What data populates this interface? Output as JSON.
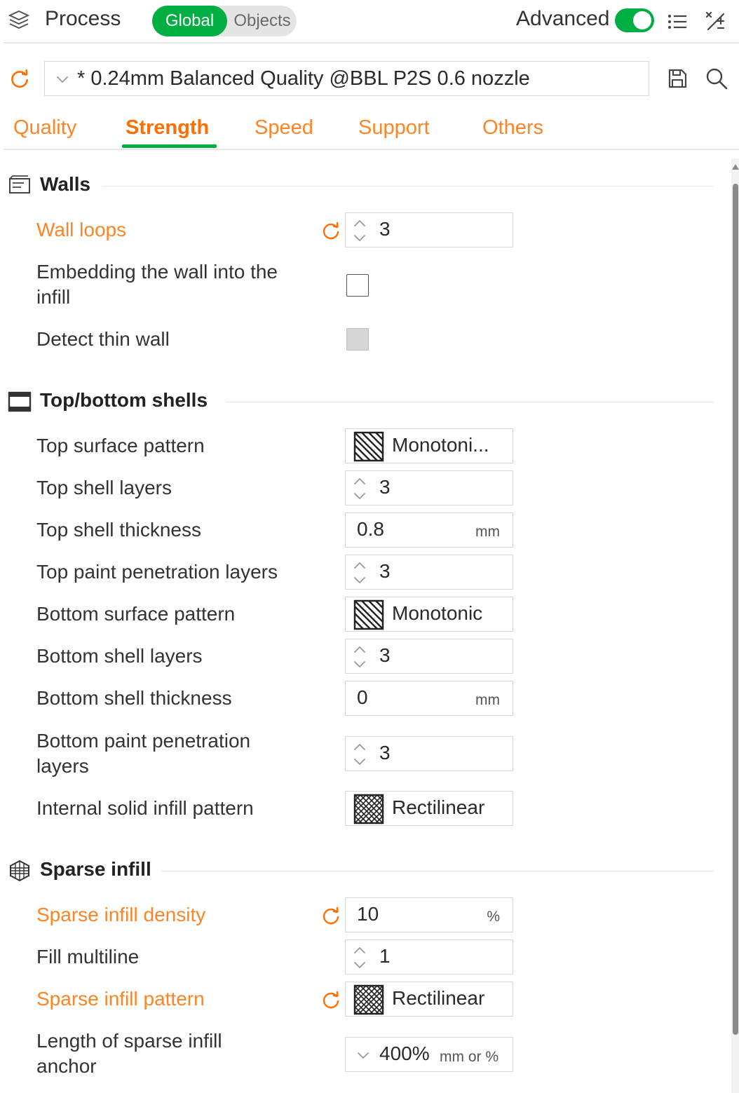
{
  "header": {
    "title": "Process",
    "segment": {
      "global": "Global",
      "objects": "Objects"
    },
    "advanced_label": "Advanced",
    "advanced_enabled": true
  },
  "preset": {
    "name": "* 0.24mm Balanced Quality @BBL P2S 0.6 nozzle"
  },
  "tabs": [
    {
      "label": "Quality",
      "active": false
    },
    {
      "label": "Strength",
      "active": true
    },
    {
      "label": "Speed",
      "active": false
    },
    {
      "label": "Support",
      "active": false
    },
    {
      "label": "Others",
      "active": false
    }
  ],
  "sections": {
    "walls": {
      "title": "Walls",
      "wall_loops": {
        "label": "Wall loops",
        "value": "3",
        "modified": true
      },
      "embed_wall": {
        "label_line1": "Embedding the wall into the",
        "label_line2": "infill",
        "checked": false
      },
      "detect_thin_wall": {
        "label": "Detect thin wall",
        "checked": false,
        "disabled": true
      }
    },
    "top_bottom": {
      "title": "Top/bottom shells",
      "top_surface_pattern": {
        "label": "Top surface pattern",
        "value": "Monotoni..."
      },
      "top_shell_layers": {
        "label": "Top shell layers",
        "value": "3"
      },
      "top_shell_thickness": {
        "label": "Top shell thickness",
        "value": "0.8",
        "unit": "mm"
      },
      "top_paint_penetration": {
        "label": "Top paint penetration layers",
        "value": "3"
      },
      "bottom_surface_pattern": {
        "label": "Bottom surface pattern",
        "value": "Monotonic"
      },
      "bottom_shell_layers": {
        "label": "Bottom shell layers",
        "value": "3"
      },
      "bottom_shell_thickness": {
        "label": "Bottom shell thickness",
        "value": "0",
        "unit": "mm"
      },
      "bottom_paint_penetration": {
        "label_line1": "Bottom paint penetration",
        "label_line2": "layers",
        "value": "3"
      },
      "internal_solid_pattern": {
        "label": "Internal solid infill pattern",
        "value": "Rectilinear"
      }
    },
    "sparse_infill": {
      "title": "Sparse infill",
      "density": {
        "label": "Sparse infill density",
        "value": "10",
        "unit": "%",
        "modified": true
      },
      "fill_multiline": {
        "label": "Fill multiline",
        "value": "1"
      },
      "pattern": {
        "label": "Sparse infill pattern",
        "value": "Rectilinear",
        "modified": true
      },
      "anchor_length": {
        "label_line1": "Length of sparse infill",
        "label_line2": "anchor",
        "value": "400%",
        "unit": "mm or %"
      }
    }
  },
  "colors": {
    "accent_green": "#00ae42",
    "modified_orange": "#ff6f00",
    "text": "#333333",
    "border": "#d8d8d8"
  },
  "icons": {
    "process": "process-icon",
    "list": "list-icon",
    "compare": "compare-icon",
    "reset": "reset-icon",
    "save": "save-icon",
    "search": "search-icon",
    "walls": "walls-icon",
    "shells": "shells-icon",
    "infill": "infill-icon",
    "spin": "spin-icon",
    "pattern_monotonic": "monotonic-pattern-icon",
    "pattern_rectilinear": "rectilinear-pattern-icon"
  }
}
